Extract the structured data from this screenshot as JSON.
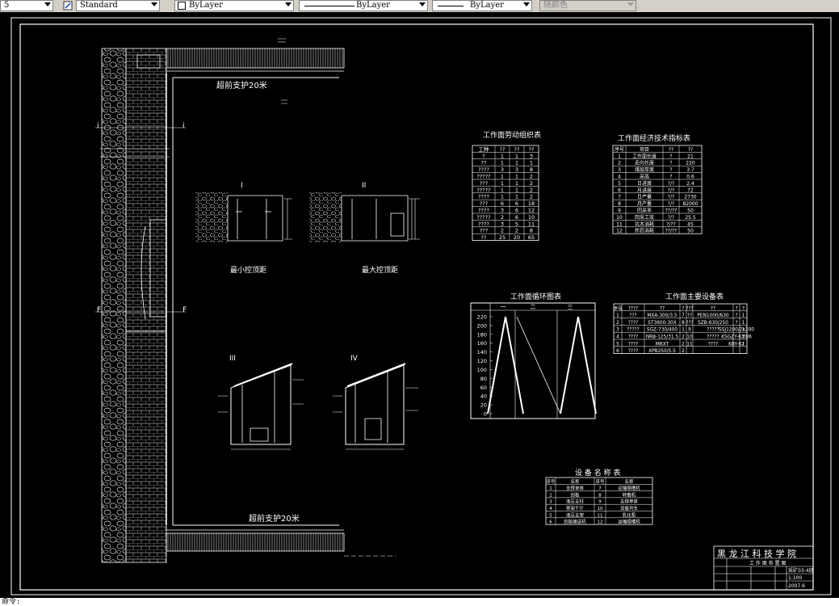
{
  "toolbar": {
    "textstyle_partial": "5",
    "textstyle": "Standard",
    "layer": "ByLayer",
    "linetype": "ByLayer",
    "lineweight": "ByLayer",
    "plotstyle": "随颜色"
  },
  "drawing": {
    "top_label": "超前支护20米",
    "bottom_label": "超前支护20米",
    "section_min": "最小控顶距",
    "section_max": "最大控顶距",
    "sec_i": "I",
    "sec_ii": "II",
    "sec_iii": "III",
    "sec_iv": "IV",
    "table1_title": "工作面劳动组织表",
    "table2_title": "工作面经济技术指标表",
    "chart_title": "工作面循环图表",
    "table3_title": "工作面主要设备表",
    "table4_title": "设 备 名 称 表",
    "title_block_school": "黑 龙 江 科 技 学 院",
    "title_block_drawing": "工 作 面 布 置 图",
    "title_block_code": "采矿03-4班",
    "title_block_scale": "1:100",
    "title_block_date": "2007.6"
  },
  "table1": {
    "header": [
      "工种",
      "??",
      "??",
      "??"
    ],
    "rows": [
      [
        "?",
        "1",
        "1",
        "3"
      ],
      [
        "??",
        "1",
        "1",
        "1"
      ],
      [
        "????",
        "3",
        "3",
        "8"
      ],
      [
        "?????",
        "1",
        "1",
        "2"
      ],
      [
        "???",
        "1",
        "1",
        "2"
      ],
      [
        "?????",
        "1",
        "1",
        "2"
      ],
      [
        "????",
        "1",
        "1",
        "2"
      ],
      [
        "???",
        "6",
        "6",
        "18"
      ],
      [
        "????",
        "3",
        "6",
        "12"
      ],
      [
        "?????",
        "2",
        "6",
        "10"
      ],
      [
        "????",
        "3",
        "5",
        "11"
      ],
      [
        "???",
        "2",
        "2",
        "8"
      ],
      [
        "??",
        "25",
        "20",
        "65"
      ]
    ]
  },
  "table2": {
    "header": [
      "序号",
      "项目",
      "??",
      "??"
    ],
    "rows": [
      [
        "1",
        "工作面长度",
        "?",
        "21"
      ],
      [
        "2",
        "走向长度",
        "?",
        "220"
      ],
      [
        "3",
        "煤层厚度",
        "?",
        "3.7"
      ],
      [
        "4",
        "采高",
        "?",
        "0.6"
      ],
      [
        "5",
        "日进度",
        "?/?",
        "2.4"
      ],
      [
        "6",
        "月进度",
        "?/?",
        "72"
      ],
      [
        "7",
        "日产量",
        "?/?",
        "2730"
      ],
      [
        "8",
        "月产量",
        "?/?",
        "82000"
      ],
      [
        "9",
        "回采率",
        "??/??",
        "50"
      ],
      [
        "10",
        "回采工效",
        "?/?",
        "25.5"
      ],
      [
        "11",
        "坑木消耗",
        "?/??",
        "45"
      ],
      [
        "12",
        "炸药消耗",
        "??/??",
        "50"
      ]
    ]
  },
  "table3": {
    "header": [
      "序号",
      "????",
      "??",
      "?",
      "???",
      "??",
      "?",
      "?"
    ],
    "rows": [
      [
        "1",
        "???",
        "MXA-300/3.5",
        "7",
        "??",
        "PEN1000/630",
        "?",
        "1"
      ],
      [
        "2",
        "????",
        "ST3600-30X",
        "8",
        "???",
        "SZB-630/250",
        "?",
        "1"
      ],
      [
        "3",
        "?????",
        "SGZ-730/400",
        "1",
        "9",
        "?????",
        "SSJ1200/2x200",
        "1"
      ],
      [
        "4",
        "????",
        "NRB-125/31.5",
        "2",
        "10",
        "?????",
        "KSGZY-630/6",
        "2"
      ],
      [
        "5",
        "????",
        "MRXT",
        "2",
        "11",
        "????",
        "KBY-62",
        "1"
      ],
      [
        "6",
        "????",
        "XPB250/5.5",
        "2",
        "",
        "",
        "",
        ""
      ]
    ]
  },
  "table4": {
    "header": [
      "序号",
      "名称",
      "序号",
      "名称"
    ],
    "rows": [
      [
        "1",
        "支撑单体",
        "7",
        "运输顺槽机"
      ],
      [
        "2",
        "刮板",
        "8",
        "转载机"
      ],
      [
        "3",
        "液压支柱",
        "9",
        "支撑单体"
      ],
      [
        "4",
        "移架千斤",
        "10",
        "设备列车"
      ],
      [
        "5",
        "液压支架",
        "11",
        "乳化泵"
      ],
      [
        "6",
        "刮板输送机",
        "12",
        "运输顺槽机"
      ]
    ]
  },
  "chart": {
    "y_ticks": [
      "220",
      "200",
      "180",
      "160",
      "140",
      "120",
      "100",
      "80",
      "60",
      "40",
      "20",
      "0"
    ],
    "top_headers": [
      "一",
      "二",
      "三"
    ]
  },
  "cmdline": "命令:"
}
